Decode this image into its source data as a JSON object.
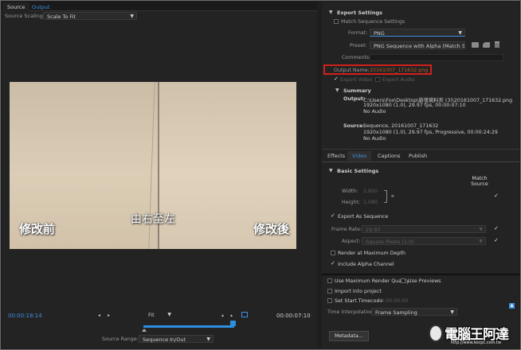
{
  "left": {
    "tabs": [
      "Source",
      "Output"
    ],
    "source_scaling_label": "Source Scaling:",
    "source_scaling_value": "Scale To Fit",
    "captions": {
      "before": "修改前",
      "direction": "由右至左",
      "after": "修改後"
    },
    "timecode_current": "00:00:18:14",
    "fit_value": "Fit",
    "timecode_duration": "00:00:07:10",
    "source_range_label": "Source Range:",
    "source_range_value": "Sequence In/Out"
  },
  "export": {
    "title": "Export Settings",
    "match_sequence": "Match Sequence Settings",
    "format_label": "Format:",
    "format_value": "PNG",
    "preset_label": "Preset:",
    "preset_value": "PNG Sequence with Alpha (Match Source",
    "comments_label": "Comments:",
    "output_name_label": "Output Name:",
    "output_name_value": "20161007_171632.png",
    "export_video": "Export Video",
    "export_audio": "Export Audio"
  },
  "summary": {
    "title": "Summary",
    "output_label": "Output:",
    "output_lines": [
      "C:\\Users\\Fox\\Desktop\\新增資料夾 (3)\\20161007_171632.png",
      "1920x1080 (1.0), 29.97 fps, 00:00:07:10",
      "No Audio"
    ],
    "source_label": "Source:",
    "source_lines": [
      "Sequence, 20161007_171632",
      "1920x1080 (1.0), 29.97 fps, Progressive, 00:00:24:29",
      "No Audio"
    ]
  },
  "tabs": [
    "Effects",
    "Video",
    "Captions",
    "Publish"
  ],
  "basic": {
    "title": "Basic Settings",
    "match_source": "Match Source",
    "width_label": "Width:",
    "width_value": "1,920",
    "height_label": "Height:",
    "height_value": "1,080",
    "export_as_sequence": "Export As Sequence",
    "frame_rate_label": "Frame Rate:",
    "frame_rate_value": "29.97",
    "aspect_label": "Aspect:",
    "aspect_value": "Square Pixels (1.0)",
    "render_max_depth": "Render at Maximum Depth",
    "include_alpha": "Include Alpha Channel"
  },
  "bottom": {
    "max_render_quality": "Use Maximum Render Quality",
    "use_previews": "Use Previews",
    "import_project": "Import into project",
    "set_start_timecode": "Set Start Timecode",
    "start_timecode_value": "00:00:00:00",
    "time_interp_label": "Time Interpolation:",
    "time_interp_value": "Frame Sampling",
    "metadata_button": "Metadata...",
    "watermark_text": "電腦王阿達",
    "watermark_url": "http://www.kocpc.com.tw"
  },
  "colors": {
    "accent": "#3d8fe0",
    "highlight": "#d0201c",
    "panel": "#232323"
  }
}
